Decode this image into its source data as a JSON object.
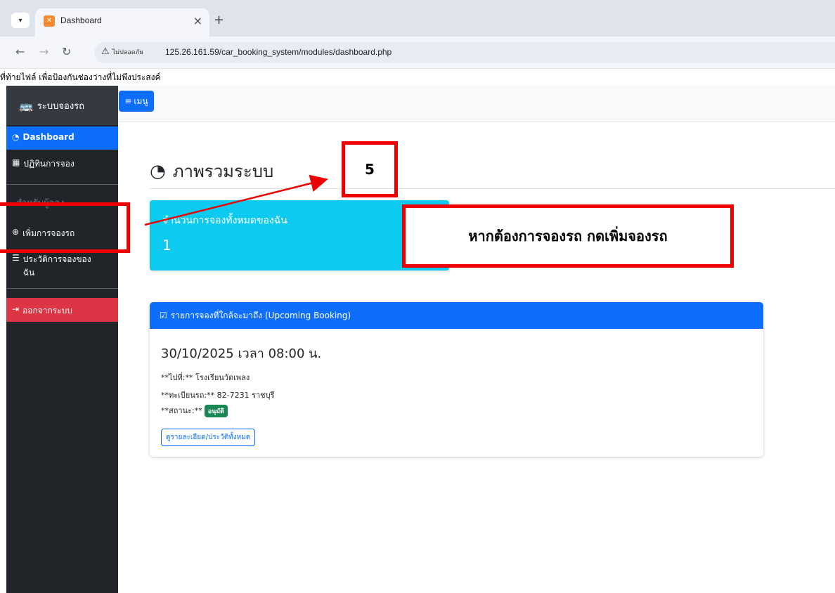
{
  "browser": {
    "tab_title": "Dashboard",
    "tab_close": "×",
    "new_tab": "+",
    "security_warning": "ไม่ปลอดภัย",
    "url": "125.26.161.59/car_booking_system/modules/dashboard.php"
  },
  "notice": "ที่ท้ายไฟล์ เพื่อป้องกันช่องว่างที่ไม่พึงประสงค์",
  "sidebar": {
    "brand": "ระบบจองรถ",
    "items": [
      {
        "label": "Dashboard",
        "icon": "speedometer-icon"
      },
      {
        "label": "ปฏิทินการจอง",
        "icon": "calendar-icon"
      }
    ],
    "section_heading": "สำหรับผู้จอง",
    "user_items": [
      {
        "label": "เพิ่มการจองรถ",
        "icon": "plus-circle-icon"
      },
      {
        "label": "ประวัติการจองของฉัน",
        "icon": "list-icon"
      }
    ],
    "logout": "ออกจากระบบ"
  },
  "topbar": {
    "menu_label": "เมนู"
  },
  "main": {
    "title": "ภาพรวมระบบ",
    "stat": {
      "label": "จำนวนการจองทั้งหมดของฉัน",
      "value": "1"
    },
    "upcoming": {
      "header": "รายการจองที่ใกล้จะมาถึง (Upcoming Booking)",
      "datetime": "30/10/2025 เวลา 08:00 น.",
      "destination": "**ไปที่:** โรงเรียนวัดเพลง",
      "plate": "**ทะเบียนรถ:** 82-7231 ราชบุรี",
      "status_label": "**สถานะ:**",
      "status_badge": "อนุมัติ",
      "detail_button": "ดูรายละเอียด/ประวัติทั้งหมด"
    }
  },
  "annotations": {
    "step_number": "5",
    "instruction": "หากต้องการจองรถ กดเพิ่มจองรถ",
    "color": "#e00000"
  },
  "colors": {
    "primary": "#0d6efd",
    "info": "#0dcaf0",
    "danger": "#dc3545",
    "success": "#198754",
    "sidebar": "#212529"
  }
}
